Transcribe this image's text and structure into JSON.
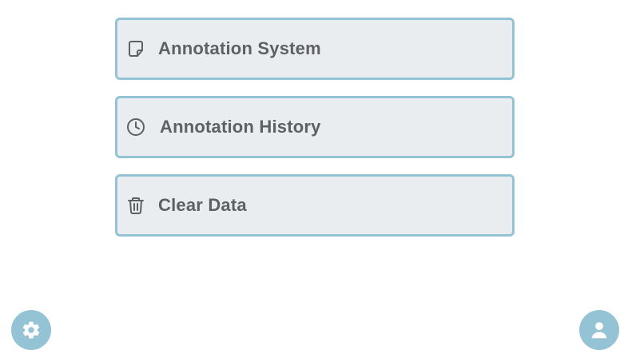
{
  "menu": {
    "items": [
      {
        "label": "Annotation System",
        "icon": "sticky-note-icon"
      },
      {
        "label": "Annotation History",
        "icon": "clock-icon"
      },
      {
        "label": "Clear Data",
        "icon": "trash-icon"
      }
    ]
  },
  "floating": {
    "settings_icon": "gear-icon",
    "profile_icon": "user-icon"
  },
  "colors": {
    "button_background": "#e9edef",
    "button_border": "#95c3d6",
    "text": "#5f6062",
    "fab_background": "#95c3d6"
  }
}
